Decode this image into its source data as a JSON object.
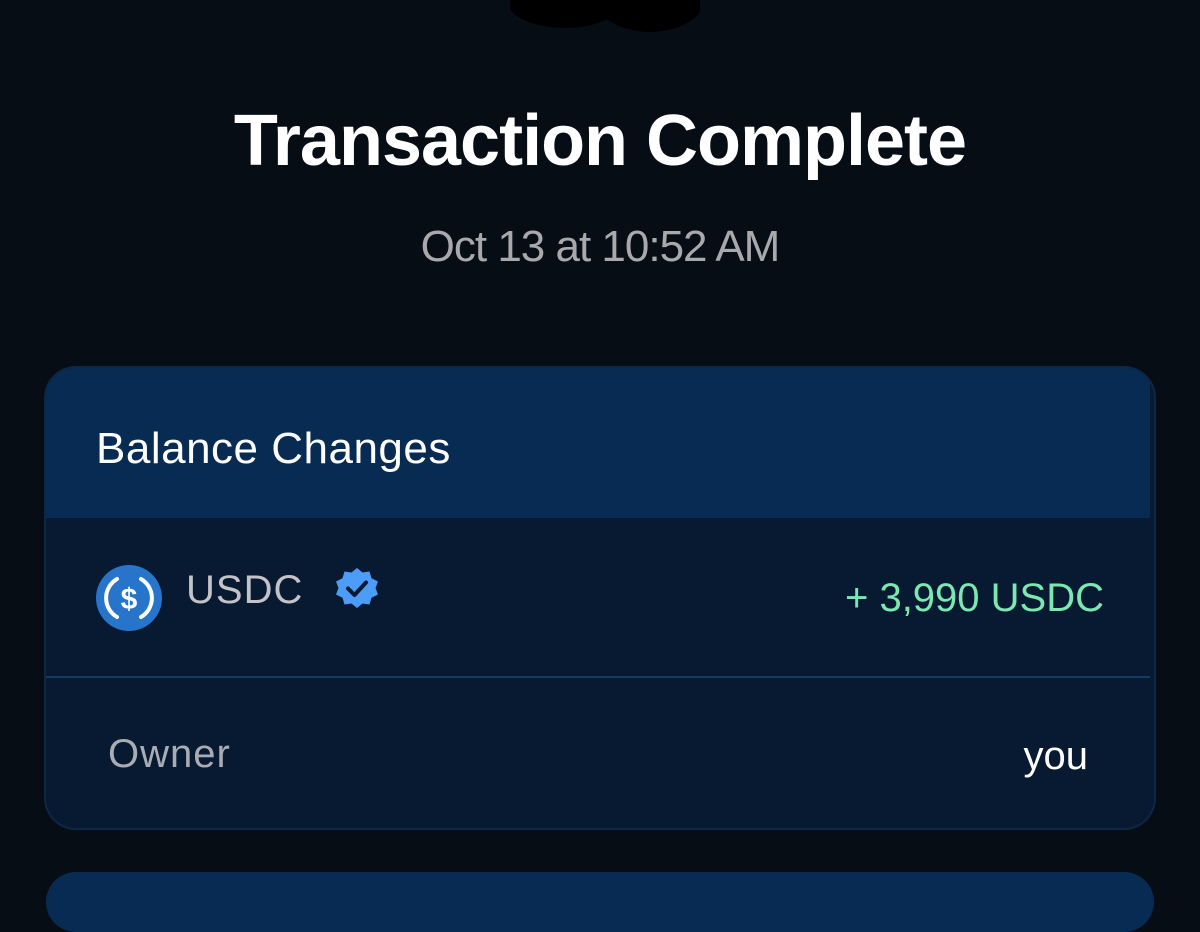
{
  "page": {
    "title": "Transaction Complete",
    "timestamp": "Oct 13 at 10:52 AM"
  },
  "balance_card": {
    "header": "Balance Changes",
    "token": {
      "name": "USDC",
      "icon": "usdc-logo-icon",
      "verified_icon": "verified-badge-icon",
      "amount": "+ 3,990 USDC"
    },
    "owner": {
      "label": "Owner",
      "value": "you"
    }
  },
  "colors": {
    "background": "#070d15",
    "card_header": "#082b54",
    "card_body": "#071a31",
    "positive_amount": "#7ae8b0",
    "usdc_blue": "#2775ca",
    "verified_blue": "#4b9df7"
  }
}
